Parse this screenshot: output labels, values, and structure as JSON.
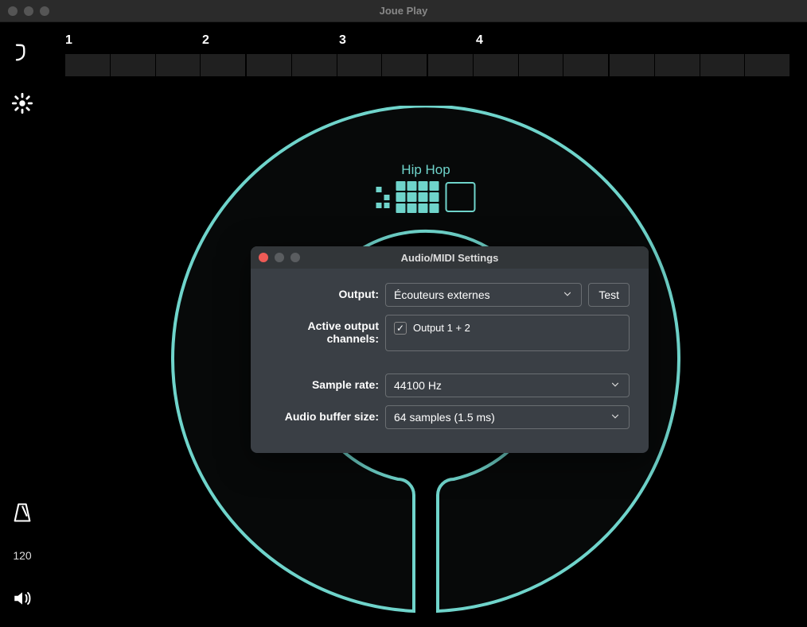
{
  "app": {
    "title": "Joue Play"
  },
  "timeline": {
    "marks": [
      "1",
      "2",
      "3",
      "4"
    ]
  },
  "sidebar": {
    "tempo": "120"
  },
  "instrument": {
    "preset": "Hip Hop",
    "accent": "#6fd4cb"
  },
  "modal": {
    "title": "Audio/MIDI Settings",
    "output_label": "Output:",
    "output_value": "Écouteurs externes",
    "test_label": "Test",
    "channels_label": "Active output channels:",
    "channel_option": "Output 1 + 2",
    "sample_rate_label": "Sample rate:",
    "sample_rate_value": "44100 Hz",
    "buffer_label": "Audio buffer size:",
    "buffer_value": "64 samples (1.5 ms)"
  }
}
